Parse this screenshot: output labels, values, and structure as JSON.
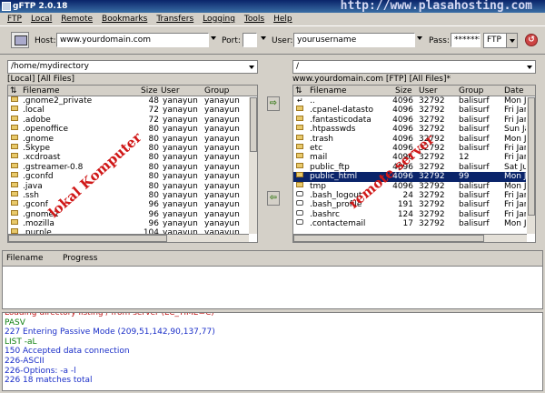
{
  "window": {
    "title": "gFTP 2.0.18",
    "watermark": "http://www.plasahosting.com"
  },
  "menu": [
    "FTP",
    "Local",
    "Remote",
    "Bookmarks",
    "Transfers",
    "Logging",
    "Tools",
    "Help"
  ],
  "toolbar": {
    "host_label": "Host:",
    "host_value": "www.yourdomain.com",
    "port_label": "Port:",
    "port_value": "",
    "user_label": "User:",
    "user_value": "yourusername",
    "pass_label": "Pass:",
    "pass_value": "********",
    "protocol": "FTP"
  },
  "local": {
    "path": "/home/mydirectory",
    "status": "[Local] [All Files]",
    "columns": [
      "Filename",
      "Size",
      "User",
      "Group"
    ],
    "rows": [
      {
        "name": ".gnome2_private",
        "size": "48",
        "user": "yanayun",
        "group": "yanayun",
        "icon": "folder"
      },
      {
        "name": ".local",
        "size": "72",
        "user": "yanayun",
        "group": "yanayun",
        "icon": "folder"
      },
      {
        "name": ".adobe",
        "size": "72",
        "user": "yanayun",
        "group": "yanayun",
        "icon": "folder"
      },
      {
        "name": ".openoffice",
        "size": "80",
        "user": "yanayun",
        "group": "yanayun",
        "icon": "folder"
      },
      {
        "name": ".gnome",
        "size": "80",
        "user": "yanayun",
        "group": "yanayun",
        "icon": "folder"
      },
      {
        "name": ".Skype",
        "size": "80",
        "user": "yanayun",
        "group": "yanayun",
        "icon": "folder"
      },
      {
        "name": ".xcdroast",
        "size": "80",
        "user": "yanayun",
        "group": "yanayun",
        "icon": "folder"
      },
      {
        "name": ".gstreamer-0.8",
        "size": "80",
        "user": "yanayun",
        "group": "yanayun",
        "icon": "folder"
      },
      {
        "name": ".gconfd",
        "size": "80",
        "user": "yanayun",
        "group": "yanayun",
        "icon": "folder"
      },
      {
        "name": ".java",
        "size": "80",
        "user": "yanayun",
        "group": "yanayun",
        "icon": "folder"
      },
      {
        "name": ".ssh",
        "size": "80",
        "user": "yanayun",
        "group": "yanayun",
        "icon": "folder"
      },
      {
        "name": ".gconf",
        "size": "96",
        "user": "yanayun",
        "group": "yanayun",
        "icon": "folder"
      },
      {
        "name": ".gnome2",
        "size": "96",
        "user": "yanayun",
        "group": "yanayun",
        "icon": "folder"
      },
      {
        "name": ".mozilla",
        "size": "96",
        "user": "yanayun",
        "group": "yanayun",
        "icon": "folder"
      },
      {
        "name": ".purple",
        "size": "104",
        "user": "yanayun",
        "group": "yanayun",
        "icon": "folder"
      }
    ]
  },
  "remote": {
    "path": "/",
    "status": "www.yourdomain.com [FTP] [All Files]*",
    "columns": [
      "Filename",
      "Size",
      "User",
      "Group",
      "Date"
    ],
    "rows": [
      {
        "name": "..",
        "size": "4096",
        "user": "32792",
        "group": "balisurf",
        "date": "Mon Ja",
        "icon": "up"
      },
      {
        "name": ".cpanel-datasto",
        "size": "4096",
        "user": "32792",
        "group": "balisurf",
        "date": "Fri Jan",
        "icon": "folder"
      },
      {
        "name": ".fantasticodata",
        "size": "4096",
        "user": "32792",
        "group": "balisurf",
        "date": "Fri Jan",
        "icon": "folder"
      },
      {
        "name": ".htpasswds",
        "size": "4096",
        "user": "32792",
        "group": "balisurf",
        "date": "Sun Jar",
        "icon": "folder"
      },
      {
        "name": ".trash",
        "size": "4096",
        "user": "32792",
        "group": "balisurf",
        "date": "Mon Ja",
        "icon": "folder"
      },
      {
        "name": "etc",
        "size": "4096",
        "user": "32792",
        "group": "balisurf",
        "date": "Fri Jan",
        "icon": "folder"
      },
      {
        "name": "mail",
        "size": "4096",
        "user": "32792",
        "group": "12",
        "date": "Fri Jan",
        "icon": "folder"
      },
      {
        "name": "public_ftp",
        "size": "4096",
        "user": "32792",
        "group": "balisurf",
        "date": "Sat Jur",
        "icon": "folder"
      },
      {
        "name": "public_html",
        "size": "4096",
        "user": "32792",
        "group": "99",
        "date": "Mon Ja",
        "icon": "folder",
        "selected": true
      },
      {
        "name": "tmp",
        "size": "4096",
        "user": "32792",
        "group": "balisurf",
        "date": "Mon Ja",
        "icon": "folder"
      },
      {
        "name": ".bash_logout",
        "size": "24",
        "user": "32792",
        "group": "balisurf",
        "date": "Fri Jan",
        "icon": "file"
      },
      {
        "name": ".bash_profile",
        "size": "191",
        "user": "32792",
        "group": "balisurf",
        "date": "Fri Jan",
        "icon": "file"
      },
      {
        "name": ".bashrc",
        "size": "124",
        "user": "32792",
        "group": "balisurf",
        "date": "Fri Jan",
        "icon": "file"
      },
      {
        "name": ".contactemail",
        "size": "17",
        "user": "32792",
        "group": "balisurf",
        "date": "Mon Ja",
        "icon": "file"
      }
    ]
  },
  "overlays": {
    "local_label": "lokal Komputer",
    "remote_label": "remote server"
  },
  "transfers": {
    "columns": [
      "Filename",
      "Progress"
    ]
  },
  "log": [
    {
      "text": "Loading directory listing / from server (LC_TIME=C)",
      "color": "#c01010"
    },
    {
      "text": "PASV",
      "color": "#108010"
    },
    {
      "text": "227 Entering Passive Mode (209,51,142,90,137,77)",
      "color": "#1a2ec8"
    },
    {
      "text": "LIST -aL",
      "color": "#108010"
    },
    {
      "text": "150 Accepted data connection",
      "color": "#1a2ec8"
    },
    {
      "text": "226-ASCII",
      "color": "#1a2ec8"
    },
    {
      "text": "226-Options: -a -l",
      "color": "#1a2ec8"
    },
    {
      "text": "226 18 matches total",
      "color": "#1a2ec8"
    }
  ]
}
